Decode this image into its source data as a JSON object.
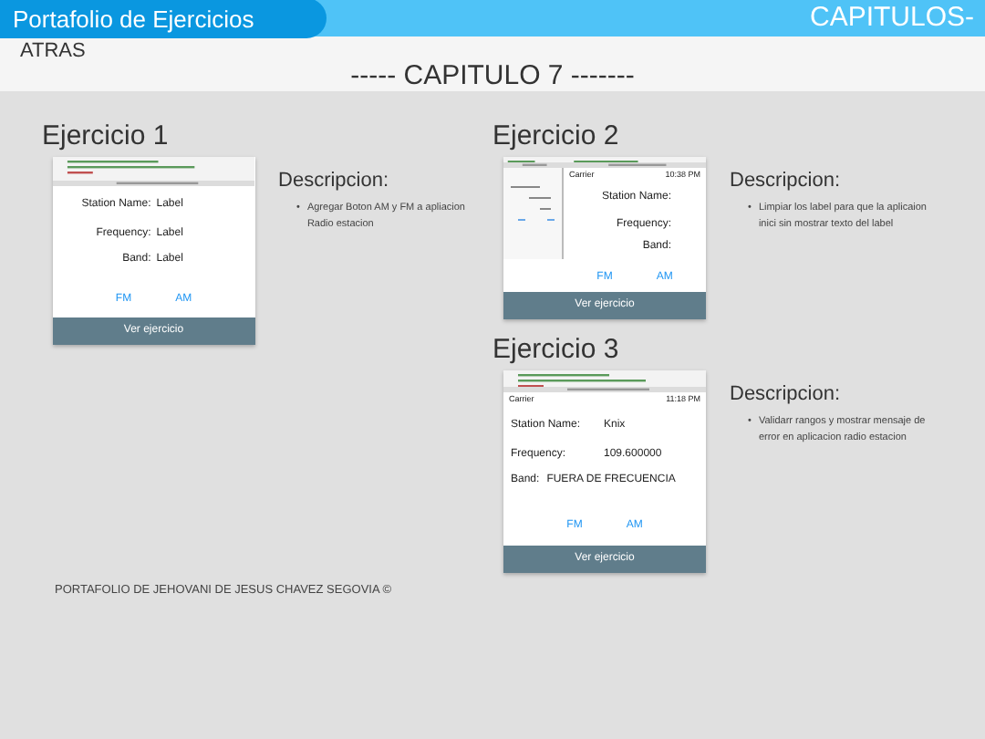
{
  "header": {
    "brand": "Portafolio de Ejercicios",
    "menu": "CAPITULOS-"
  },
  "subheader": {
    "back": "ATRAS",
    "title": "----- CAPITULO 7 -------"
  },
  "columns": [
    {
      "exercises": [
        {
          "title": "Ejercicio 1",
          "screen": {
            "fields": [
              {
                "kind": "pair",
                "label": "Station Name:",
                "value": "Label"
              },
              {
                "kind": "pair",
                "label": "Frequency:",
                "value": "Label"
              },
              {
                "kind": "pair",
                "label": "Band:",
                "value": "Label"
              }
            ],
            "buttons": [
              "FM",
              "AM"
            ]
          },
          "button": "Ver ejercicio",
          "heading": "Descripcion:",
          "items": [
            {
              "bullet": "•",
              "text": "Agregar Boton AM y FM a apliacion Radio estacion"
            }
          ]
        }
      ]
    },
    {
      "exercises": [
        {
          "title": "Ejercicio 2",
          "screen": {
            "side_preview": true,
            "status": {
              "carrier": "Carrier",
              "time": "10:38 PM"
            },
            "fields": [
              {
                "kind": "pair",
                "label": "Station Name:"
              },
              {
                "kind": "pair",
                "label": "Frequency:"
              },
              {
                "kind": "pair",
                "label": "Band:"
              }
            ],
            "buttons": [
              "FM",
              "AM"
            ]
          },
          "button": "Ver ejercicio",
          "heading": "Descripcion:",
          "items": [
            {
              "bullet": "•",
              "text": "Limpiar los label para que la aplicaion inici sin mostrar texto del label"
            }
          ]
        },
        {
          "title": "Ejercicio 3",
          "screen": {
            "status": {
              "carrier": "Carrier",
              "time": "11:18 PM"
            },
            "fields": [
              {
                "kind": "pair",
                "label": "Station Name:",
                "value": "Knix"
              },
              {
                "kind": "pair",
                "label": "Frequency:",
                "value": "109.600000"
              },
              {
                "kind": "inline",
                "label": "Band:",
                "value": "FUERA DE FRECUENCIA"
              }
            ],
            "buttons": [
              "FM",
              "AM"
            ]
          },
          "button": "Ver ejercicio",
          "heading": "Descripcion:",
          "items": [
            {
              "bullet": "•",
              "text": "Validarr rangos y mostrar mensaje de error en aplicacion radio estacion"
            }
          ]
        }
      ]
    }
  ],
  "footer": "PORTAFOLIO DE JEHOVANI DE JESUS CHAVEZ SEGOVIA ©"
}
